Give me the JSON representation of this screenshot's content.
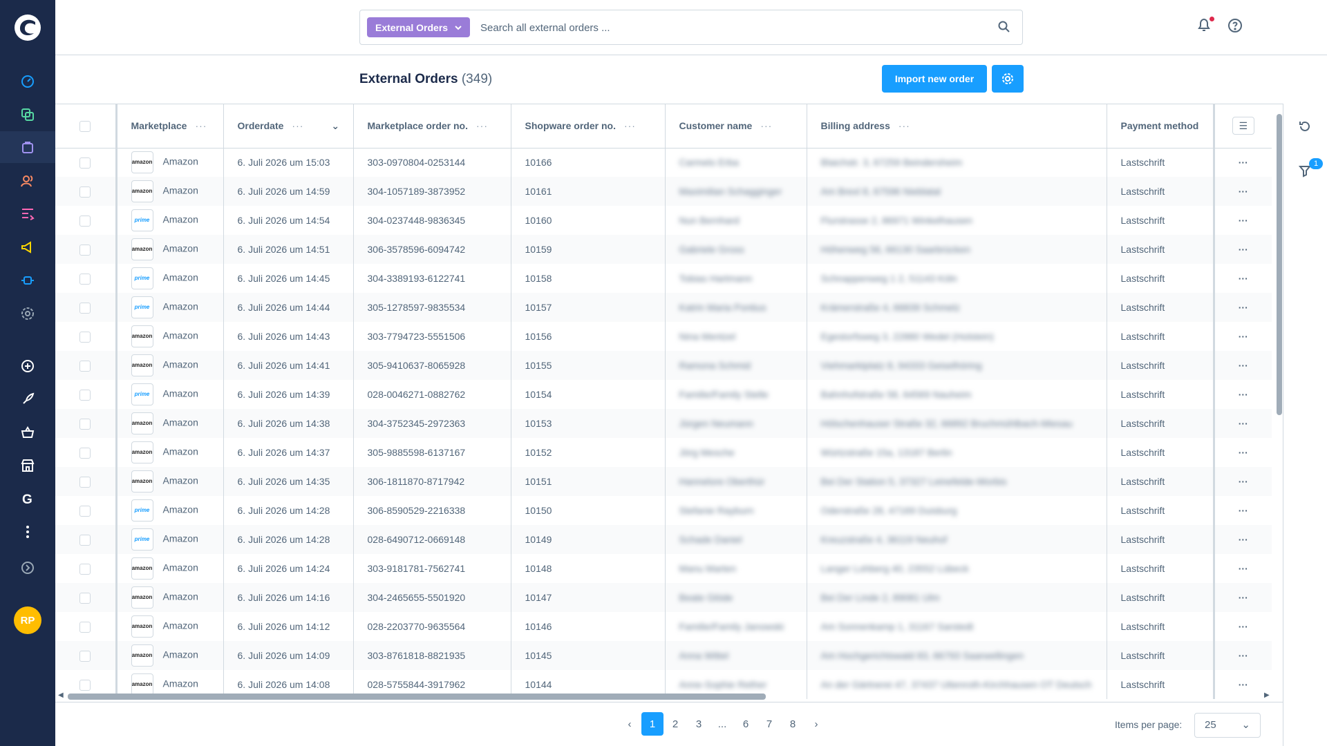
{
  "colors": {
    "sidebar": "#1b2a4a",
    "accent": "#189eff",
    "search_type_bg": "#9a7cd8",
    "avatar": "#ffbd01",
    "notification_dot": "#de294c"
  },
  "user": {
    "initials": "RP"
  },
  "search": {
    "type_label": "External Orders",
    "placeholder": "Search all external orders ..."
  },
  "page": {
    "title": "External Orders",
    "count": "(349)"
  },
  "toolbar": {
    "import_label": "Import new order"
  },
  "filter_badge": "1",
  "columns": {
    "marketplace": "Marketplace",
    "orderdate": "Orderdate",
    "marketplace_order_no": "Marketplace order no.",
    "shopware_order_no": "Shopware order no.",
    "customer_name": "Customer name",
    "billing_address": "Billing address",
    "payment_method": "Payment method",
    "dots": "···"
  },
  "rows": [
    {
      "logo": "amazon",
      "marketplace": "Amazon",
      "date": "6. Juli 2026 um 15:03",
      "mp_no": "303-0970804-0253144",
      "sw_no": "10166",
      "customer": "Carmelo Erba",
      "address": "Blaichstr. 3, 67259 Beindersheim",
      "payment": "Lastschrift"
    },
    {
      "logo": "amazon",
      "marketplace": "Amazon",
      "date": "6. Juli 2026 um 14:59",
      "mp_no": "304-1057189-3873952",
      "sw_no": "10161",
      "customer": "Maximilian Schagginger",
      "address": "Am Brexl 8, 67596 Nieblatal",
      "payment": "Lastschrift"
    },
    {
      "logo": "prime",
      "marketplace": "Amazon",
      "date": "6. Juli 2026 um 14:54",
      "mp_no": "304-0237448-9836345",
      "sw_no": "10160",
      "customer": "Nun Bernhard",
      "address": "Flurstrasse 2, 86971 Winkelhausen",
      "payment": "Lastschrift"
    },
    {
      "logo": "amazon",
      "marketplace": "Amazon",
      "date": "6. Juli 2026 um 14:51",
      "mp_no": "306-3578596-6094742",
      "sw_no": "10159",
      "customer": "Gabriele Gross",
      "address": "Höhenweg 56, 66130 Saarbrücken",
      "payment": "Lastschrift"
    },
    {
      "logo": "prime",
      "marketplace": "Amazon",
      "date": "6. Juli 2026 um 14:45",
      "mp_no": "304-3389193-6122741",
      "sw_no": "10158",
      "customer": "Tobias Hartmann",
      "address": "Schnappenweg 1 2, 51143 Köln",
      "payment": "Lastschrift"
    },
    {
      "logo": "prime",
      "marketplace": "Amazon",
      "date": "6. Juli 2026 um 14:44",
      "mp_no": "305-1278597-9835534",
      "sw_no": "10157",
      "customer": "Katrin Maria Pontius",
      "address": "Krämerstraße 4, 66839 Schmelz",
      "payment": "Lastschrift"
    },
    {
      "logo": "amazon",
      "marketplace": "Amazon",
      "date": "6. Juli 2026 um 14:43",
      "mp_no": "303-7794723-5551506",
      "sw_no": "10156",
      "customer": "Nina Mentzel",
      "address": "Egestorfsweg 3, 22880 Wedel (Holstein)",
      "payment": "Lastschrift"
    },
    {
      "logo": "amazon",
      "marketplace": "Amazon",
      "date": "6. Juli 2026 um 14:41",
      "mp_no": "305-9410637-8065928",
      "sw_no": "10155",
      "customer": "Ramona Schmid",
      "address": "Viehmarktplatz 8, 94333 Geiselhöring",
      "payment": "Lastschrift"
    },
    {
      "logo": "prime",
      "marketplace": "Amazon",
      "date": "6. Juli 2026 um 14:39",
      "mp_no": "028-0046271-0882762",
      "sw_no": "10154",
      "customer": "Familie/Family Stelle",
      "address": "Bahnhofstraße 58, 64569 Nauheim",
      "payment": "Lastschrift"
    },
    {
      "logo": "amazon",
      "marketplace": "Amazon",
      "date": "6. Juli 2026 um 14:38",
      "mp_no": "304-3752345-2972363",
      "sw_no": "10153",
      "customer": "Jürgen Neumann",
      "address": "Hölschenhauser Straße 32, 66892 Bruchmühlbach-Miesau",
      "payment": "Lastschrift"
    },
    {
      "logo": "amazon",
      "marketplace": "Amazon",
      "date": "6. Juli 2026 um 14:37",
      "mp_no": "305-9885598-6137167",
      "sw_no": "10152",
      "customer": "Jörg Mesche",
      "address": "Würtzstraße 15a, 13187 Berlin",
      "payment": "Lastschrift"
    },
    {
      "logo": "amazon",
      "marketplace": "Amazon",
      "date": "6. Juli 2026 um 14:35",
      "mp_no": "306-1811870-8717942",
      "sw_no": "10151",
      "customer": "Hannelore Oberthür",
      "address": "Bei Der Station 5, 37327 Leinefelde-Worbis",
      "payment": "Lastschrift"
    },
    {
      "logo": "prime",
      "marketplace": "Amazon",
      "date": "6. Juli 2026 um 14:28",
      "mp_no": "306-8590529-2216338",
      "sw_no": "10150",
      "customer": "Stefanie Rayburn",
      "address": "Oderstraße 28, 47169 Duisburg",
      "payment": "Lastschrift"
    },
    {
      "logo": "prime",
      "marketplace": "Amazon",
      "date": "6. Juli 2026 um 14:28",
      "mp_no": "028-6490712-0669148",
      "sw_no": "10149",
      "customer": "Schade Daniel",
      "address": "Kreuzstraße 4, 36119 Neuhof",
      "payment": "Lastschrift"
    },
    {
      "logo": "amazon",
      "marketplace": "Amazon",
      "date": "6. Juli 2026 um 14:24",
      "mp_no": "303-9181781-7562741",
      "sw_no": "10148",
      "customer": "Manu Marten",
      "address": "Langer Lohberg 40, 23552 Lübeck",
      "payment": "Lastschrift"
    },
    {
      "logo": "amazon",
      "marketplace": "Amazon",
      "date": "6. Juli 2026 um 14:16",
      "mp_no": "304-2465655-5501920",
      "sw_no": "10147",
      "customer": "Beate Glöde",
      "address": "Bei Der Linde 2, 89081 Ulm",
      "payment": "Lastschrift"
    },
    {
      "logo": "amazon",
      "marketplace": "Amazon",
      "date": "6. Juli 2026 um 14:12",
      "mp_no": "028-2203770-9635564",
      "sw_no": "10146",
      "customer": "Familie/Family Janowski",
      "address": "Am Sonnenkamp 1, 31167 Sarstedt",
      "payment": "Lastschrift"
    },
    {
      "logo": "amazon",
      "marketplace": "Amazon",
      "date": "6. Juli 2026 um 14:09",
      "mp_no": "303-8761818-8821935",
      "sw_no": "10145",
      "customer": "Anna Wittel",
      "address": "Am Hochgerichtswald 83, 66793 Saarwellingen",
      "payment": "Lastschrift"
    },
    {
      "logo": "amazon",
      "marketplace": "Amazon",
      "date": "6. Juli 2026 um 14:08",
      "mp_no": "028-5755844-3917962",
      "sw_no": "10144",
      "customer": "Anne-Sophie Rether",
      "address": "An der Gärtnerei 47, 37437 Uttenroth-Kirchhausen OT Deutsch",
      "payment": "Lastschrift"
    }
  ],
  "pagination": {
    "pages": [
      "1",
      "2",
      "3",
      "...",
      "6",
      "7",
      "8"
    ],
    "current": "1",
    "items_label": "Items per page:",
    "items_value": "25"
  }
}
